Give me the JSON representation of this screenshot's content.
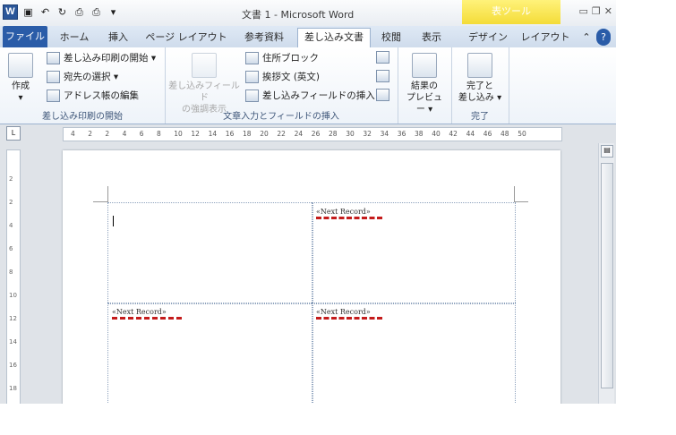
{
  "window": {
    "title": "文書 1 - Microsoft Word",
    "context_tool": "表ツール"
  },
  "tabs": {
    "file": "ファイル",
    "home": "ホーム",
    "insert": "挿入",
    "layout": "ページ レイアウト",
    "references": "参考資料",
    "mailings": "差し込み文書",
    "review": "校閲",
    "view": "表示",
    "design": "デザイン",
    "table_layout": "レイアウト"
  },
  "ribbon": {
    "create": "作成",
    "start_merge": "差し込み印刷の開始",
    "select_recipients": "宛先の選択",
    "edit_list": "アドレス帳の編集",
    "group_start": "差し込み印刷の開始",
    "highlight_fields": "差し込みフィールド",
    "highlight_fields2": "の強調表示",
    "address_block": "住所ブロック",
    "greeting_line": "挨拶文 (英文)",
    "insert_field": "差し込みフィールドの挿入",
    "group_write": "文章入力とフィールドの挿入",
    "preview_results": "結果の",
    "preview_results2": "プレビュー",
    "finish_merge": "完了と",
    "finish_merge2": "差し込み",
    "group_finish": "完了"
  },
  "ruler": {
    "ticks": [
      "4",
      "2",
      "2",
      "4",
      "6",
      "8",
      "10",
      "12",
      "14",
      "16",
      "18",
      "20",
      "22",
      "24",
      "26",
      "28",
      "30",
      "32",
      "34",
      "36",
      "38",
      "40",
      "42",
      "44",
      "46",
      "48",
      "50"
    ]
  },
  "vruler": {
    "ticks": [
      "2",
      "2",
      "4",
      "6",
      "8",
      "10",
      "12",
      "14",
      "16",
      "18"
    ]
  },
  "document": {
    "next_record": "«Next Record»"
  },
  "colors": {
    "accent": "#2a5ca8",
    "context": "#f4dc38",
    "squiggle": "#c41c1c"
  }
}
